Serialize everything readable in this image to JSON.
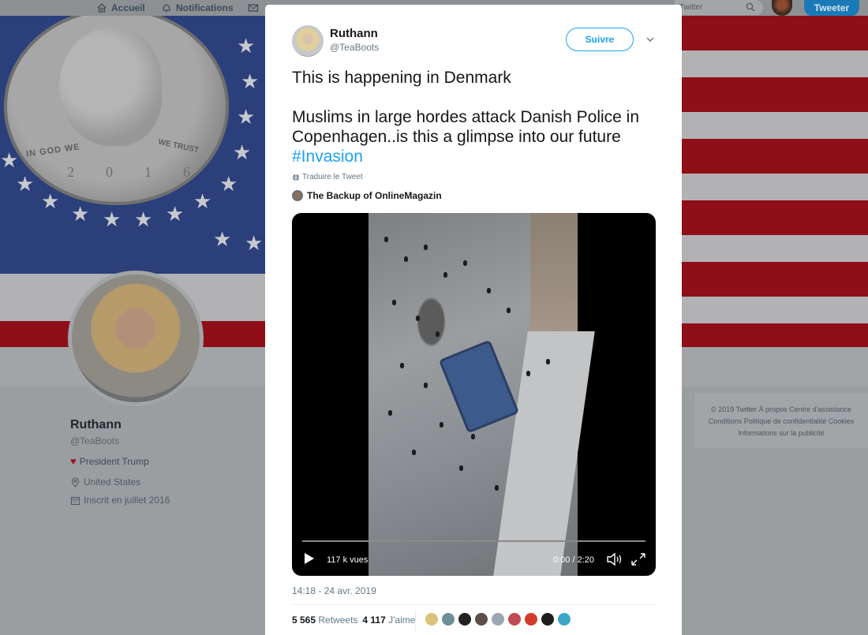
{
  "nav": {
    "home_label": "Accueil",
    "notifications_label": "Notifications",
    "search_value": "Twitter",
    "tweet_button": "Tweeter"
  },
  "banner": {
    "coin_legend_left": "IN GOD WE",
    "coin_legend_right": "WE TRUST",
    "coin_year": "2016"
  },
  "profile": {
    "name": "Ruthann",
    "handle": "@TeaBoots",
    "bio": "President Trump",
    "location": "United States",
    "joined": "Inscrit en juillet 2016"
  },
  "footer": {
    "line1": "© 2019 Twitter   À propos   Centre d'assistance",
    "line2": "Conditions   Politique de confidentialité   Cookies",
    "line3": "Informations sur la publicité"
  },
  "tweet": {
    "author_name": "Ruthann",
    "author_handle": "@TeaBoots",
    "follow_label": "Suivre",
    "text_line1": "This is happening in Denmark",
    "text_line2": "Muslims in large hordes attack Danish Police in Copenhagen..is this a glimpse into our future ",
    "hashtag": "#Invasion",
    "translate_label": "Traduire le Tweet",
    "source_account": "The Backup of OnlineMagazin",
    "video": {
      "views": "117 k vues",
      "time": "0:00 / 2:20",
      "progress": 0
    },
    "date": "14:18 - 24 avr. 2019",
    "retweets_count": "5 565",
    "retweets_label": "Retweets",
    "likes_count": "4 117",
    "likes_label": "J'aime"
  },
  "colors": {
    "accent": "#1da1f2",
    "follow_border": "#1da1f2",
    "tweet_button": "#1a7ab8",
    "overlay_bg": "#9b9ea0",
    "flag_red": "#8e0f18",
    "flag_blue": "#2b3f7a"
  },
  "icons": {
    "home": "home-icon",
    "notifications": "bell-icon",
    "messages": "envelope-icon",
    "search": "search-icon",
    "chevron": "chevron-down-icon",
    "globe": "globe-icon",
    "location": "location-pin-icon",
    "calendar": "calendar-icon",
    "heart": "heart-icon",
    "play": "play-icon",
    "volume": "volume-icon",
    "fullscreen": "fullscreen-icon"
  }
}
